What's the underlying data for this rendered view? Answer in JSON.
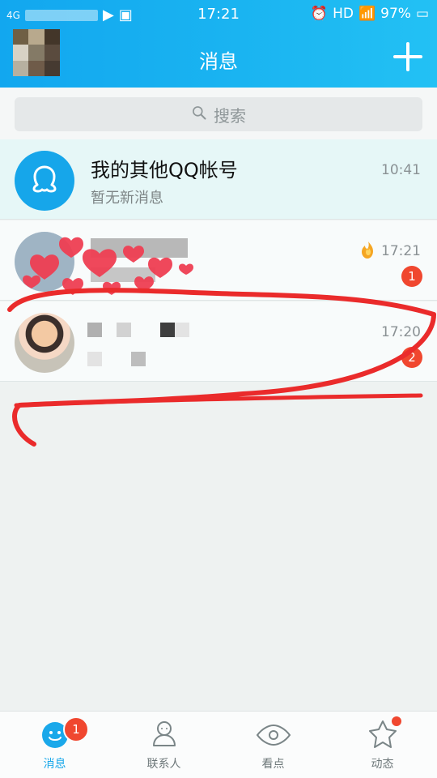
{
  "status_bar": {
    "carrier": "4G",
    "time": "17:21",
    "hd": "HD",
    "battery": "97%"
  },
  "header": {
    "title": "消息"
  },
  "search": {
    "placeholder": "搜索"
  },
  "messages": [
    {
      "title": "我的其他QQ帐号",
      "subtitle": "暂无新消息",
      "time": "10:41",
      "badge": ""
    },
    {
      "title": "",
      "subtitle": "",
      "time": "17:21",
      "badge": "1"
    },
    {
      "title": "",
      "subtitle": "",
      "time": "17:20",
      "badge": "2"
    }
  ],
  "bottom_nav": [
    {
      "label": "消息",
      "badge": "1"
    },
    {
      "label": "联系人",
      "badge": ""
    },
    {
      "label": "看点",
      "badge": ""
    },
    {
      "label": "动态",
      "badge": ""
    }
  ],
  "colors": {
    "header_start": "#12a7ef",
    "header_end": "#23c1f4",
    "accent": "#1aa8ea",
    "badge_red": "#f0472f"
  },
  "icons": {
    "search": "search-icon",
    "plus": "plus-icon",
    "qq": "qq-penguin-icon",
    "fire": "flame-icon",
    "messages": "message-icon",
    "contacts": "contacts-icon",
    "look": "eye-icon",
    "moments": "star-icon"
  }
}
